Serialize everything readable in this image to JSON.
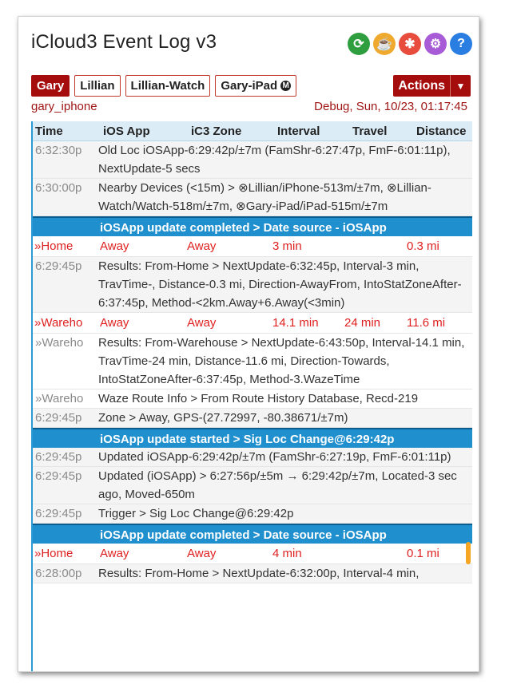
{
  "header": {
    "title": "iCloud3 Event Log v3"
  },
  "icons": [
    {
      "name": "refresh-icon",
      "color": "#2e9e3e",
      "glyph": "⟳"
    },
    {
      "name": "coffee-icon",
      "color": "#f0a92f",
      "glyph": "☕"
    },
    {
      "name": "bug-icon",
      "color": "#e74c3c",
      "glyph": "✱"
    },
    {
      "name": "gear-icon",
      "color": "#a85bd6",
      "glyph": "⚙"
    },
    {
      "name": "help-icon",
      "color": "#2a7de1",
      "glyph": "?"
    }
  ],
  "devices": [
    {
      "label": "Gary",
      "selected": true
    },
    {
      "label": "Lillian",
      "selected": false
    },
    {
      "label": "Lillian-Watch",
      "selected": false
    },
    {
      "label": "Gary-iPad",
      "selected": false,
      "badge": "M"
    }
  ],
  "actions": {
    "label": "Actions"
  },
  "status": {
    "device": "gary_iphone",
    "debug": "Debug, Sun, 10/23, 01:17:45"
  },
  "columns": [
    "Time",
    "iOS App",
    "iC3 Zone",
    "Interval",
    "Travel",
    "Distance"
  ],
  "log": [
    {
      "type": "msg",
      "time": "6:32:30p",
      "text": "Old Loc iOSApp-6:29:42p/±7m (FamShr-6:27:47p, FmF-6:01:11p), NextUpdate-5 secs",
      "bg": "gray"
    },
    {
      "type": "msg",
      "time": "6:30:00p",
      "text": "Nearby Devices (<15m) > ⊗Lillian/iPhone-513m/±7m, ⊗Lillian-Watch/Watch-518m/±7m, ⊗Gary-iPad/iPad-515m/±7m",
      "bg": "gray"
    },
    {
      "type": "banner",
      "text": "iOSApp update completed > Date source - iOSApp"
    },
    {
      "type": "red",
      "zone": "»Home",
      "ios": "Away",
      "ic3": "Away",
      "interval": "3 min",
      "travel": "",
      "distance": "0.3 mi"
    },
    {
      "type": "msg",
      "time": "6:29:45p",
      "text": "Results: From-Home > NextUpdate-6:32:45p, Interval-3 min, TravTime-, Distance-0.3 mi, Direction-AwayFrom, IntoStatZoneAfter-6:37:45p, Method-<2km.Away+6.Away(<3min)",
      "bg": "gray"
    },
    {
      "type": "red",
      "zone": "»Wareho",
      "ios": "Away",
      "ic3": "Away",
      "interval": "14.1 min",
      "travel": "24 min",
      "distance": "11.6 mi"
    },
    {
      "type": "msg",
      "time": "»Wareho",
      "text": "Results: From-Warehouse > NextUpdate-6:43:50p, Interval-14.1 min, TravTime-24 min, Distance-11.6 mi, Direction-Towards, IntoStatZoneAfter-6:37:45p, Method-3.WazeTime",
      "bg": "white"
    },
    {
      "type": "msg",
      "time": "»Wareho",
      "text": "Waze Route Info > From Route History Database, Recd-219",
      "bg": "white"
    },
    {
      "type": "msg",
      "time": "6:29:45p",
      "text": "Zone > Away, GPS-(27.72997, -80.38671/±7m)",
      "bg": "gray"
    },
    {
      "type": "banner",
      "text": "iOSApp update started > Sig Loc Change@6:29:42p"
    },
    {
      "type": "msg",
      "time": "6:29:45p",
      "text": "Updated iOSApp-6:29:42p/±7m (FamShr-6:27:19p, FmF-6:01:11p)",
      "bg": "gray"
    },
    {
      "type": "msg",
      "time": "6:29:45p",
      "text": "Updated (iOSApp) > 6:27:56p/±5m → 6:29:42p/±7m, Located-3 sec ago, Moved-650m",
      "bg": "gray"
    },
    {
      "type": "msg",
      "time": "6:29:45p",
      "text": "Trigger > Sig Loc Change@6:29:42p",
      "bg": "gray"
    },
    {
      "type": "banner",
      "text": "iOSApp update completed > Date source - iOSApp"
    },
    {
      "type": "red",
      "zone": "»Home",
      "ios": "Away",
      "ic3": "Away",
      "interval": "4 min",
      "travel": "",
      "distance": "0.1 mi"
    },
    {
      "type": "msg",
      "time": "6:28:00p",
      "text": "Results: From-Home > NextUpdate-6:32:00p, Interval-4 min,",
      "bg": "gray"
    }
  ]
}
